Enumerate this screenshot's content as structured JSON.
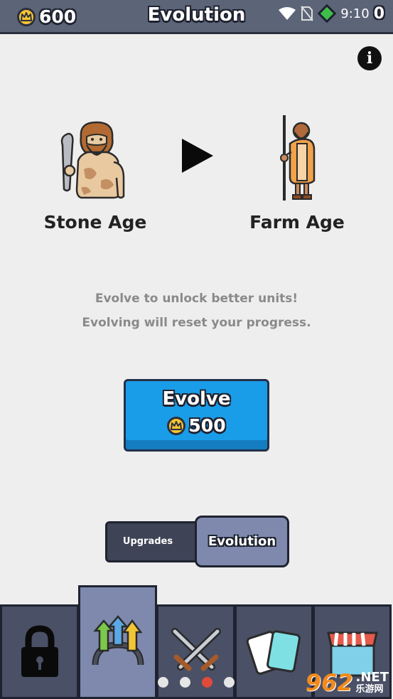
{
  "header": {
    "coins": "600",
    "title": "Evolution",
    "time": "9:10",
    "gems": "0"
  },
  "info_icon": "info-icon",
  "ages": {
    "current": {
      "label": "Stone Age",
      "icon": "caveman-icon"
    },
    "next": {
      "label": "Farm Age",
      "icon": "farmer-icon"
    }
  },
  "description": {
    "line1": "Evolve to unlock better units!",
    "line2": "Evolving will reset your progress."
  },
  "evolve_button": {
    "label": "Evolve",
    "cost": "500"
  },
  "segments": {
    "upgrades": "Upgrades",
    "evolution": "Evolution",
    "selected": "Evolution"
  },
  "bottom_nav": {
    "tabs": [
      {
        "icon": "lock-icon"
      },
      {
        "icon": "evolution-arrows-icon",
        "active": true
      },
      {
        "icon": "crossed-swords-icon"
      },
      {
        "icon": "cards-icon"
      },
      {
        "icon": "shop-icon"
      }
    ],
    "page_dots": 4,
    "active_dot": 3
  },
  "watermark": {
    "brand": "962",
    "suffix": ".NET",
    "sub": "乐游网"
  },
  "colors": {
    "topbar": "#5c6478",
    "background": "#eeeeee",
    "evolve_blue": "#1a9de8",
    "coin_gold": "#f5c432",
    "tab_active": "#7e89ad",
    "tab_inactive": "#4a5066",
    "dot_active": "#e04a3a"
  }
}
